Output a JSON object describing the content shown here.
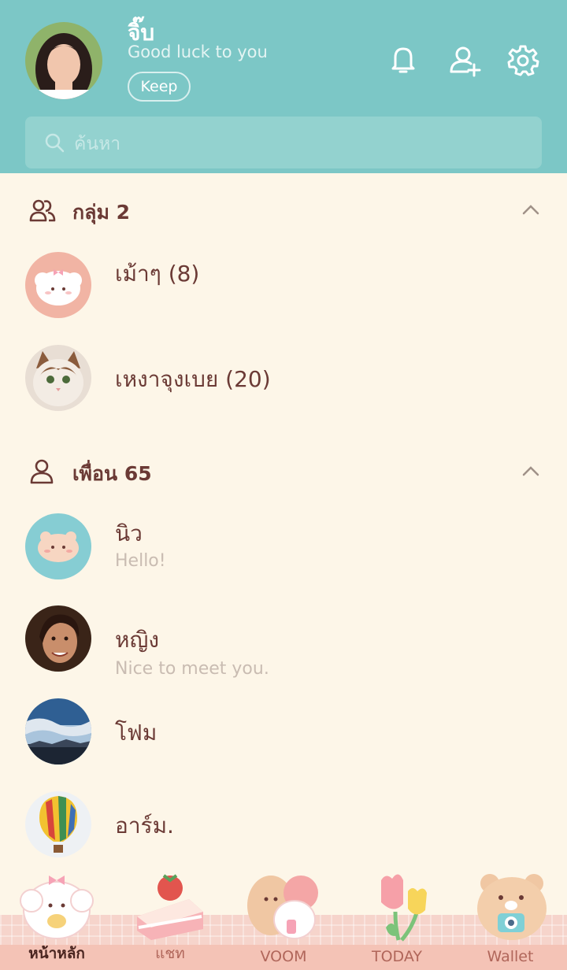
{
  "profile": {
    "name": "จิ๊บ",
    "status": "Good luck to you",
    "keep_label": "Keep"
  },
  "header_icons": [
    "bell-icon",
    "add-friend-icon",
    "gear-icon"
  ],
  "search": {
    "placeholder": "ค้นหา"
  },
  "groups": {
    "title": "กลุ่ม 2",
    "items": [
      {
        "name": "เม้าๆ (8)"
      },
      {
        "name": "เหงาจุงเบย (20)"
      }
    ]
  },
  "friends": {
    "title": "เพื่อน 65",
    "items": [
      {
        "name": "นิว",
        "status": "Hello!"
      },
      {
        "name": "หญิง",
        "status": "Nice to meet you."
      },
      {
        "name": "โฟม",
        "status": ""
      },
      {
        "name": "อาร์ม.",
        "status": ""
      }
    ]
  },
  "tabs": [
    {
      "label": "หน้าหลัก",
      "active": true
    },
    {
      "label": "แชท",
      "active": false
    },
    {
      "label": "VOOM",
      "active": false
    },
    {
      "label": "TODAY",
      "active": false
    },
    {
      "label": "Wallet",
      "active": false
    }
  ],
  "colors": {
    "header_bg": "#7cc7c6",
    "page_bg": "#fdf6e8",
    "text_primary": "#6b3a35",
    "text_secondary": "#c9bcb2",
    "tab_bg": "#f6d4cb"
  }
}
